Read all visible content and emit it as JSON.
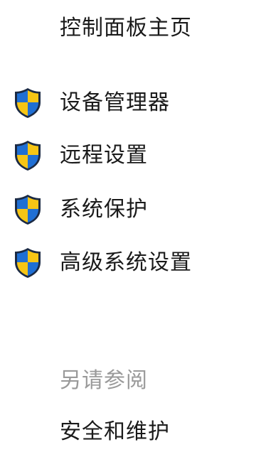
{
  "nav": {
    "home_label": "控制面板主页"
  },
  "tasks": {
    "icon": "uac-shield-icon",
    "shield_colors": {
      "blue": "#1f6fd4",
      "yellow": "#f6c515",
      "outline": "#1b2a44"
    },
    "items": [
      {
        "label": "设备管理器"
      },
      {
        "label": "远程设置"
      },
      {
        "label": "系统保护"
      },
      {
        "label": "高级系统设置"
      }
    ]
  },
  "see_also": {
    "heading": "另请参阅",
    "links": [
      {
        "label": "安全和维护"
      }
    ]
  }
}
